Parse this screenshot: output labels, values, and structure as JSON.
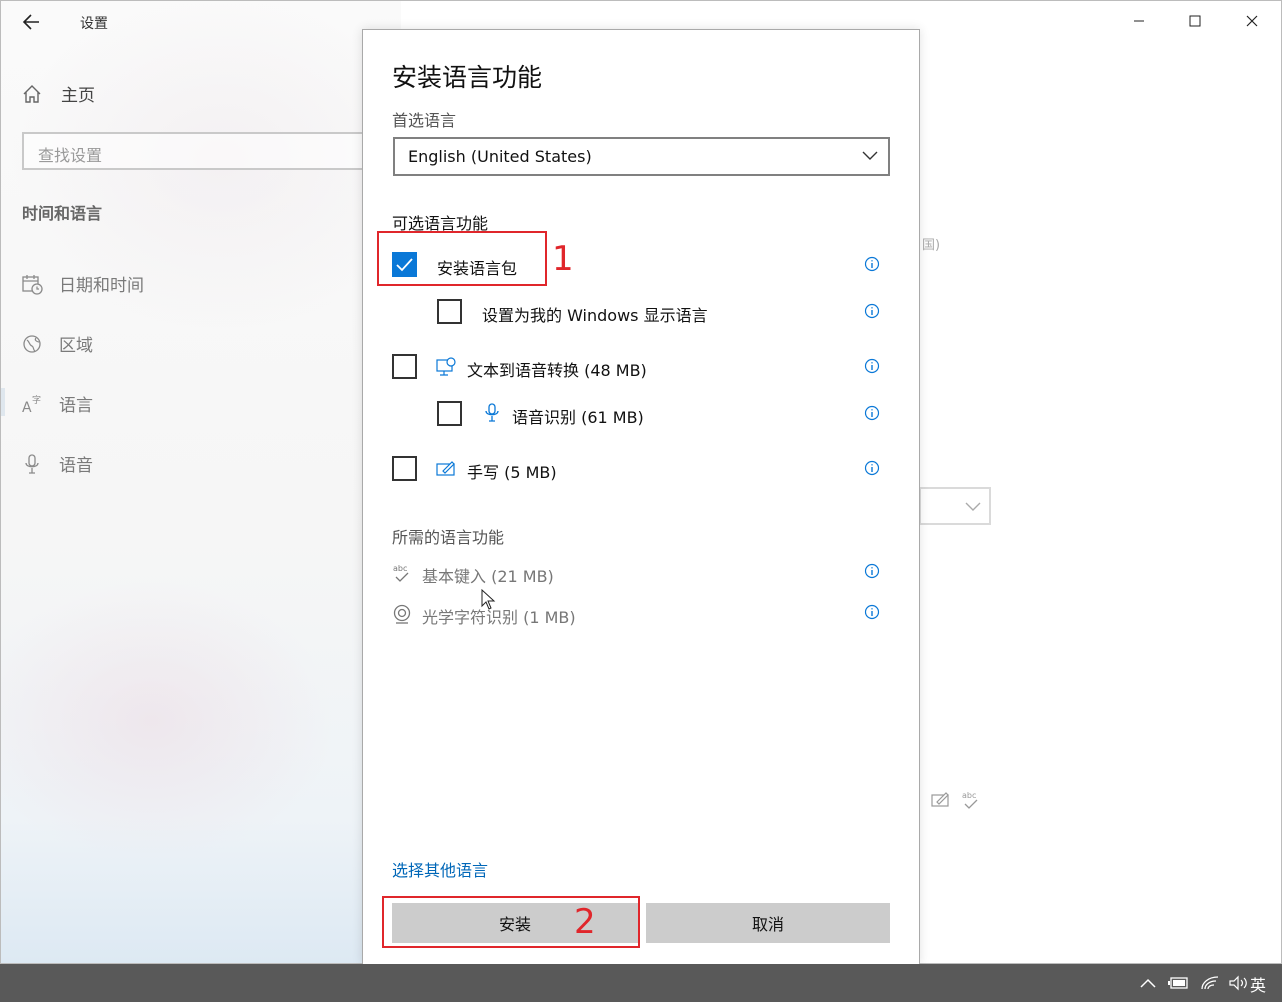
{
  "window": {
    "title": "设置"
  },
  "sidebar": {
    "home_label": "主页",
    "search_placeholder": "查找设置",
    "section_title": "时间和语言",
    "items": [
      {
        "label": "日期和时间",
        "icon": "calendar-clock-icon"
      },
      {
        "label": "区域",
        "icon": "globe-icon"
      },
      {
        "label": "语言",
        "icon": "language-icon",
        "selected": true
      },
      {
        "label": "语音",
        "icon": "microphone-icon"
      }
    ]
  },
  "background": {
    "fragment_text": "国)"
  },
  "dialog": {
    "title": "安装语言功能",
    "preferred_language_label": "首选语言",
    "preferred_language_value": "English (United States)",
    "optional_features_label": "可选语言功能",
    "options": [
      {
        "label": "安装语言包",
        "checked": true
      },
      {
        "label": "设置为我的 Windows 显示语言",
        "checked": false
      },
      {
        "label": "文本到语音转换 (48 MB)",
        "checked": false,
        "icon": "text-to-speech-icon"
      },
      {
        "label": "语音识别 (61 MB)",
        "checked": false,
        "icon": "microphone-icon"
      },
      {
        "label": "手写 (5 MB)",
        "checked": false,
        "icon": "handwriting-icon"
      }
    ],
    "required_features_label": "所需的语言功能",
    "required": [
      {
        "label": "基本键入 (21 MB)",
        "icon": "spellcheck-icon"
      },
      {
        "label": "光学字符识别 (1 MB)",
        "icon": "ocr-icon"
      }
    ],
    "choose_other_link": "选择其他语言",
    "install_button": "安装",
    "cancel_button": "取消"
  },
  "annotations": {
    "marker_1": "1",
    "marker_2": "2",
    "color": "#e0262b"
  },
  "taskbar": {
    "ime_indicator": "英"
  },
  "colors": {
    "accent": "#0a78d7",
    "link": "#0067b8",
    "button": "#cccccc",
    "taskbar": "#595959"
  }
}
